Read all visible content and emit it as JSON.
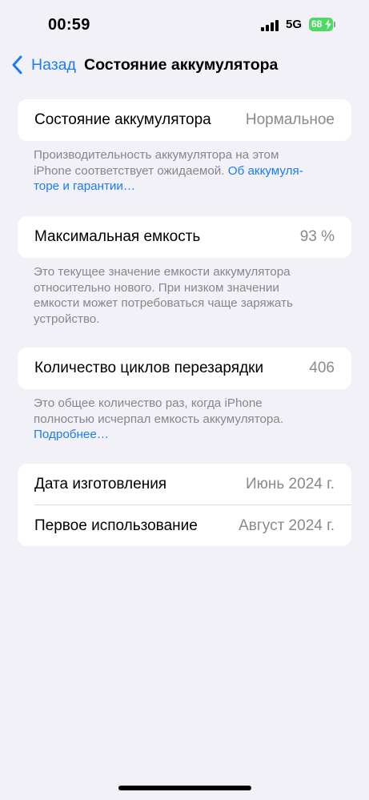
{
  "status_bar": {
    "time": "00:59",
    "network": "5G",
    "battery_level": "68"
  },
  "nav": {
    "back_label": "Назад",
    "title": "Состояние аккумулятора"
  },
  "battery_health": {
    "label": "Состояние аккумулятора",
    "value": "Нормальное",
    "note_line1": "Производительность аккумулятора на этом",
    "note_line2": "iPhone соответствует ожидаемой.",
    "note_link_part1": "Об аккумуля-",
    "note_link_part2": "торе и гарантии…"
  },
  "max_capacity": {
    "label": "Максимальная емкость",
    "value": "93 %",
    "note_lines": [
      "Это текущее значение емкости аккумулятора",
      "относительно нового. При низком значении",
      "емкости может потребоваться чаще заряжать",
      "устройство."
    ]
  },
  "cycle_count": {
    "label": "Количество циклов перезарядки",
    "value": "406",
    "note_lines": [
      "Это общее количество раз, когда iPhone",
      "полностью исчерпал емкость аккумулятора."
    ],
    "note_link": "Подробнее…"
  },
  "dates": {
    "manufacture_label": "Дата изготовления",
    "manufacture_value": "Июнь 2024 г.",
    "first_use_label": "Первое использование",
    "first_use_value": "Август 2024 г."
  },
  "colors": {
    "accent": "#1a7cf5",
    "background": "#f2f1f7",
    "battery": "#4cd964"
  }
}
